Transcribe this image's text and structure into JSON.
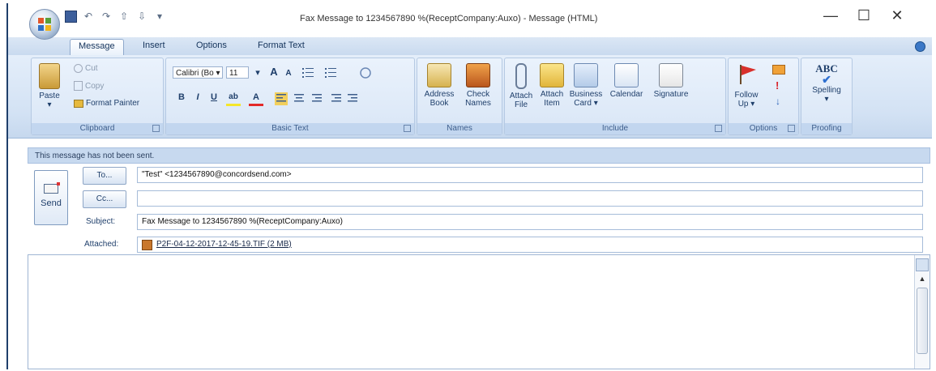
{
  "window": {
    "title": "Fax Message to 1234567890 %(ReceptCompany:Auxo) - Message (HTML)",
    "minimize": "—",
    "maximize": "☐",
    "close": "✕"
  },
  "qat": {
    "undo": "↶",
    "redo": "↷",
    "up": "⇧",
    "down": "⇩",
    "more": "▾"
  },
  "tabs": [
    {
      "label": "Message",
      "active": true
    },
    {
      "label": "Insert",
      "active": false
    },
    {
      "label": "Options",
      "active": false
    },
    {
      "label": "Format Text",
      "active": false
    }
  ],
  "ribbon": {
    "clipboard": {
      "label": "Clipboard",
      "paste": "Paste",
      "paste_arrow": "▾",
      "cut": "Cut",
      "copy": "Copy",
      "format_painter": "Format Painter"
    },
    "basic_text": {
      "label": "Basic Text",
      "font": "Calibri (Bo ▾",
      "size": "11",
      "size_arrow": "▾",
      "grow": "A",
      "shrink": "A",
      "bold": "B",
      "italic": "I",
      "underline": "U",
      "highlight": "ab",
      "font_color": "A"
    },
    "names": {
      "label": "Names",
      "address_book": "Address Book",
      "check_names": "Check Names"
    },
    "include": {
      "label": "Include",
      "attach_file": "Attach File",
      "attach_item": "Attach Item",
      "business_card": "Business Card ▾",
      "calendar": "Calendar",
      "signature": "Signature"
    },
    "options": {
      "label": "Options",
      "follow_up": "Follow Up ▾"
    },
    "proofing": {
      "label": "Proofing",
      "spelling": "Spelling",
      "abc": "ABC",
      "spelling_arrow": "▾"
    }
  },
  "infobar": {
    "text": "This message has not been sent."
  },
  "send": {
    "label": "Send"
  },
  "fields": {
    "to_button": "To...",
    "to_value": "\"Test\" <1234567890@concordsend.com>",
    "cc_button": "Cc...",
    "cc_value": "",
    "subject_label": "Subject:",
    "subject_value": "Fax Message to 1234567890 %(ReceptCompany:Auxo)",
    "attached_label": "Attached:",
    "attached_value": "P2F-04-12-2017-12-45-19.TIF (2 MB)"
  },
  "colors": {
    "ribbon": "#d3e2f4",
    "infobar": "#c7d9ef",
    "accent": "#1f3f6b"
  },
  "icons": [
    "office-button-icon",
    "save-icon",
    "undo-icon",
    "redo-icon",
    "paste-icon",
    "cut-icon",
    "copy-icon",
    "format-painter-icon",
    "address-book-icon",
    "check-names-icon",
    "paperclip-icon",
    "attach-item-icon",
    "business-card-icon",
    "calendar-icon",
    "signature-icon",
    "follow-up-flag-icon",
    "high-importance-icon",
    "low-importance-icon",
    "spelling-check-icon",
    "send-envelope-icon",
    "attachment-file-icon",
    "help-icon"
  ]
}
